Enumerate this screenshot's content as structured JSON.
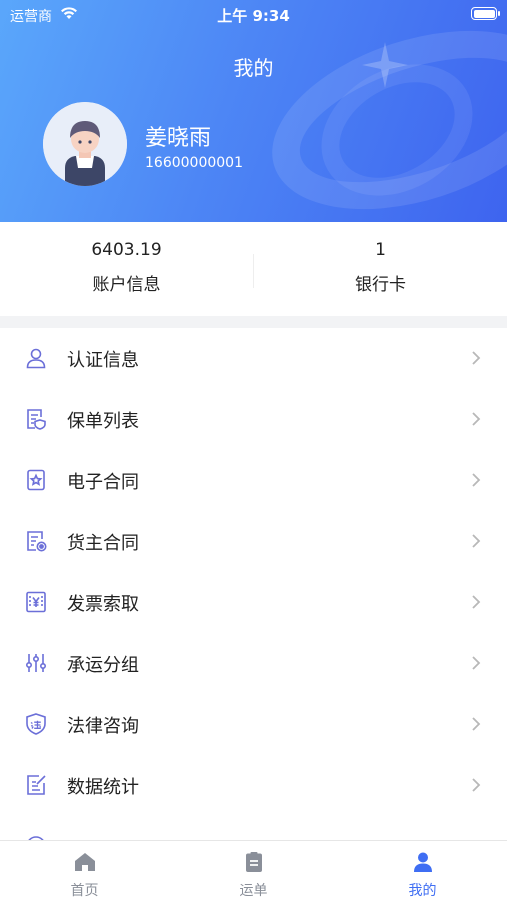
{
  "status_bar": {
    "carrier": "运营商",
    "time": "上午 9:34"
  },
  "header": {
    "title": "我的"
  },
  "profile": {
    "name": "姜晓雨",
    "phone": "16600000001"
  },
  "stats": [
    {
      "value": "6403.19",
      "label": "账户信息"
    },
    {
      "value": "1",
      "label": "银行卡"
    }
  ],
  "menu": [
    {
      "label": "认证信息",
      "icon": "user-icon"
    },
    {
      "label": "保单列表",
      "icon": "policy-list-icon"
    },
    {
      "label": "电子合同",
      "icon": "e-contract-icon"
    },
    {
      "label": "货主合同",
      "icon": "shipper-contract-icon"
    },
    {
      "label": "发票索取",
      "icon": "invoice-icon"
    },
    {
      "label": "承运分组",
      "icon": "sliders-icon"
    },
    {
      "label": "法律咨询",
      "icon": "legal-shield-icon"
    },
    {
      "label": "数据统计",
      "icon": "data-stats-icon"
    }
  ],
  "tabbar": [
    {
      "label": "首页",
      "icon": "home-icon",
      "active": false
    },
    {
      "label": "运单",
      "icon": "waybill-icon",
      "active": false
    },
    {
      "label": "我的",
      "icon": "person-icon",
      "active": true
    }
  ],
  "colors": {
    "brand": "#4d86f5",
    "active_tab": "#3f6ef3",
    "icon_tint": "#6b6fd8"
  }
}
